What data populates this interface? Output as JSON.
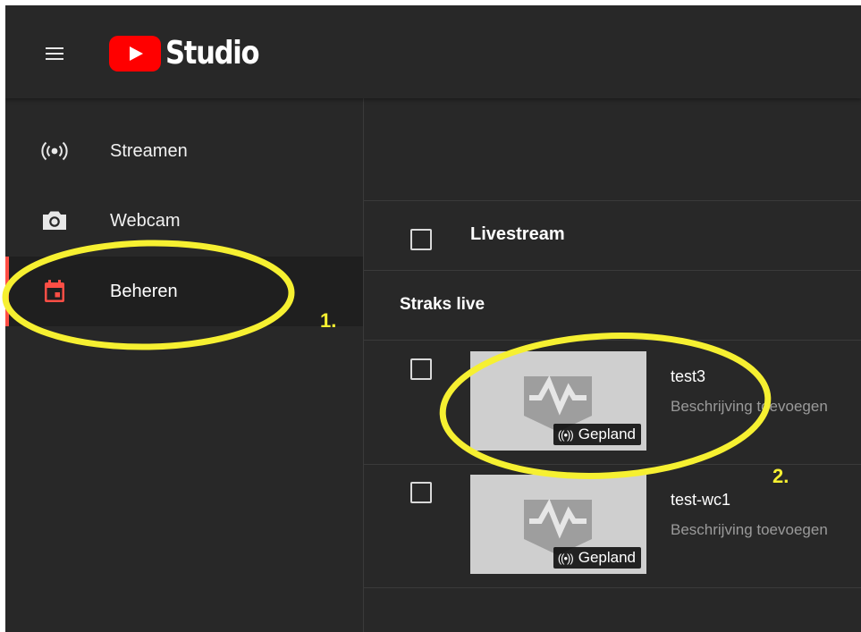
{
  "header": {
    "logo_text": "Studio"
  },
  "sidebar": {
    "items": [
      {
        "label": "Streamen",
        "icon": "live-broadcast-icon",
        "active": false
      },
      {
        "label": "Webcam",
        "icon": "camera-icon",
        "active": false
      },
      {
        "label": "Beheren",
        "icon": "calendar-icon",
        "active": true
      }
    ]
  },
  "main": {
    "column_header": "Livestream",
    "section_title": "Straks live",
    "videos": [
      {
        "title": "test3",
        "description": "Beschrijving toevoegen",
        "badge_icon": "((•))",
        "badge": "Gepland"
      },
      {
        "title": "test-wc1",
        "description": "Beschrijving toevoegen",
        "badge_icon": "((•))",
        "badge": "Gepland"
      }
    ]
  },
  "annotations": {
    "step1": "1.",
    "step2": "2."
  },
  "colors": {
    "background": "#282828",
    "accent": "#ff0000",
    "active_indicator": "#ff4e45",
    "annotation": "#f6f031",
    "thumbnail": "#cfcfcf"
  }
}
